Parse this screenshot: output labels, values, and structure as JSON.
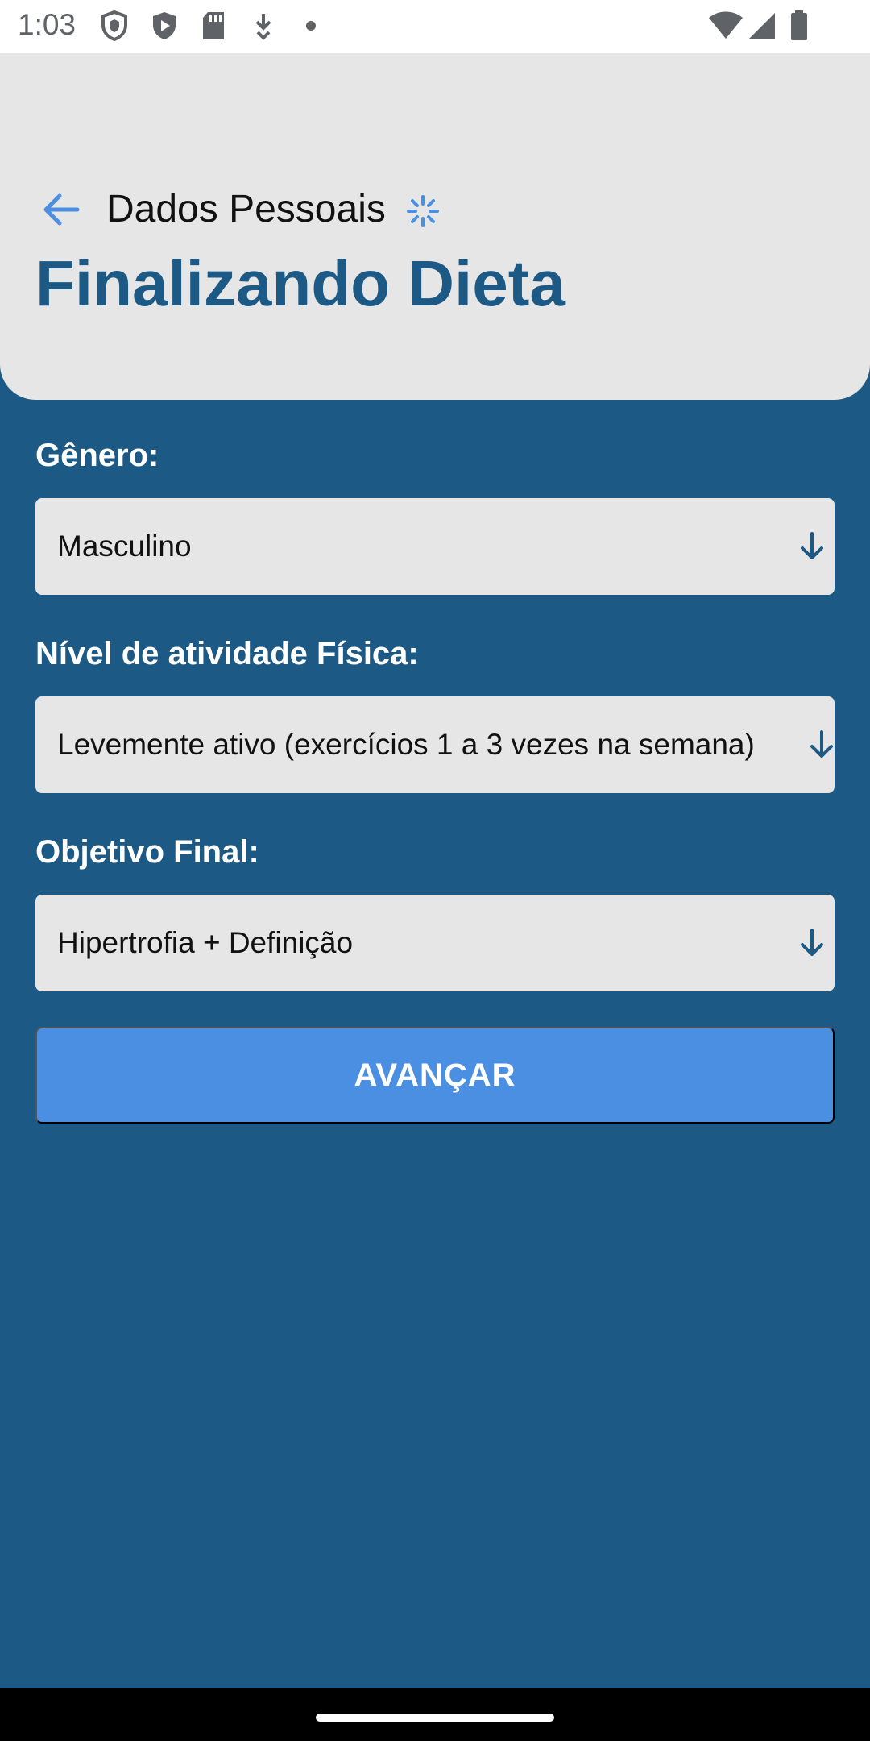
{
  "status_bar": {
    "time": "1:03",
    "left_icons": [
      "shield-outline-icon",
      "shield-play-icon",
      "sd-card-icon",
      "download-icon",
      "dot-icon"
    ],
    "right_icons": [
      "wifi-icon",
      "cellular-signal-icon",
      "battery-icon"
    ]
  },
  "header": {
    "back_icon": "arrow-left-icon",
    "subtitle": "Dados Pessoais",
    "loading_icon": "spinner-icon",
    "title": "Finalizando Dieta"
  },
  "form": {
    "gender": {
      "label": "Gênero:",
      "value": "Masculino"
    },
    "activity": {
      "label": "Nível de atividade Física:",
      "value": "Levemente ativo (exercícios 1 a 3 vezes na semana)"
    },
    "goal": {
      "label": "Objetivo Final:",
      "value": "Hipertrofia + Definição"
    },
    "submit_label": "AVANÇAR"
  },
  "colors": {
    "primary_dark": "#1c5985",
    "accent": "#4b8fe2",
    "card_bg": "#e6e6e6"
  }
}
